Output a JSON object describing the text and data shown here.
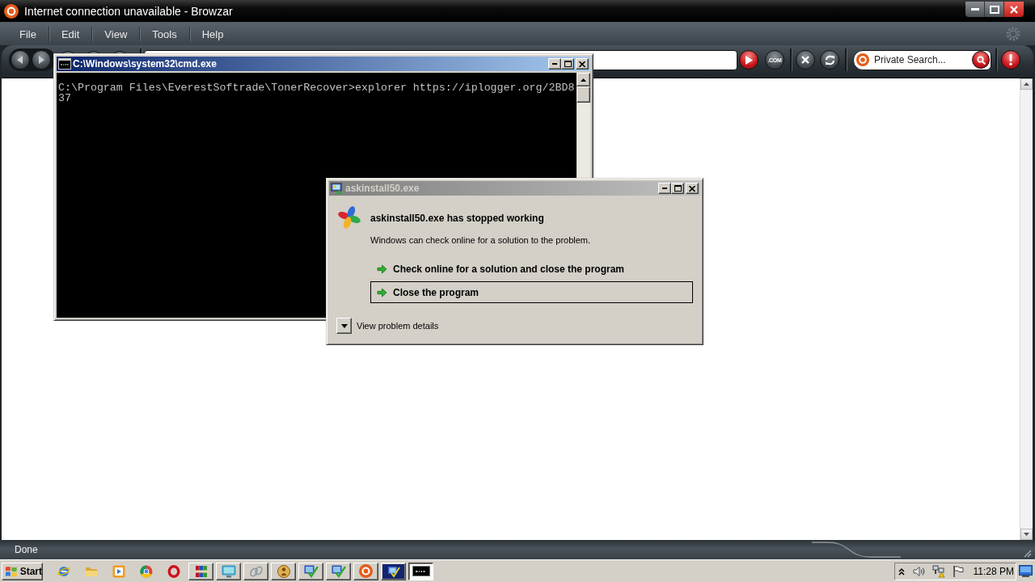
{
  "browser": {
    "title": "Internet connection unavailable - Browzar",
    "menu": [
      "File",
      "Edit",
      "View",
      "Tools",
      "Help"
    ],
    "toolbar": {
      "com_button": ".COM",
      "search": {
        "placeholder": "Private Search..."
      }
    },
    "status_bar": {
      "text": "Done"
    }
  },
  "cmd_window": {
    "title": "C:\\Windows\\system32\\cmd.exe",
    "active": true,
    "lines": [
      "C:\\Program Files\\EverestSoftrade\\TonerRecover>explorer https://iplogger.org/2BD8",
      "37"
    ]
  },
  "error_dialog": {
    "title": "askinstall50.exe",
    "active": false,
    "heading": "askinstall50.exe has stopped working",
    "message": "Windows can check online for a solution to the problem.",
    "options": [
      {
        "label": "Check online for a solution and close the program",
        "selected": false
      },
      {
        "label": "Close the program",
        "selected": true
      }
    ],
    "details_toggle": {
      "label": "View problem details",
      "expanded": false
    }
  },
  "taskbar": {
    "start": "Start",
    "tasks": [
      {
        "kind": "blocks",
        "selected": false
      },
      {
        "kind": "monitor",
        "selected": false
      },
      {
        "kind": "link",
        "selected": false
      },
      {
        "kind": "badge",
        "selected": false
      },
      {
        "kind": "check",
        "selected": false
      },
      {
        "kind": "check",
        "selected": false
      },
      {
        "kind": "logo",
        "selected": false
      },
      {
        "kind": "window",
        "selected": false
      },
      {
        "kind": "console",
        "selected": true
      }
    ],
    "clock": "11:28 PM"
  }
}
